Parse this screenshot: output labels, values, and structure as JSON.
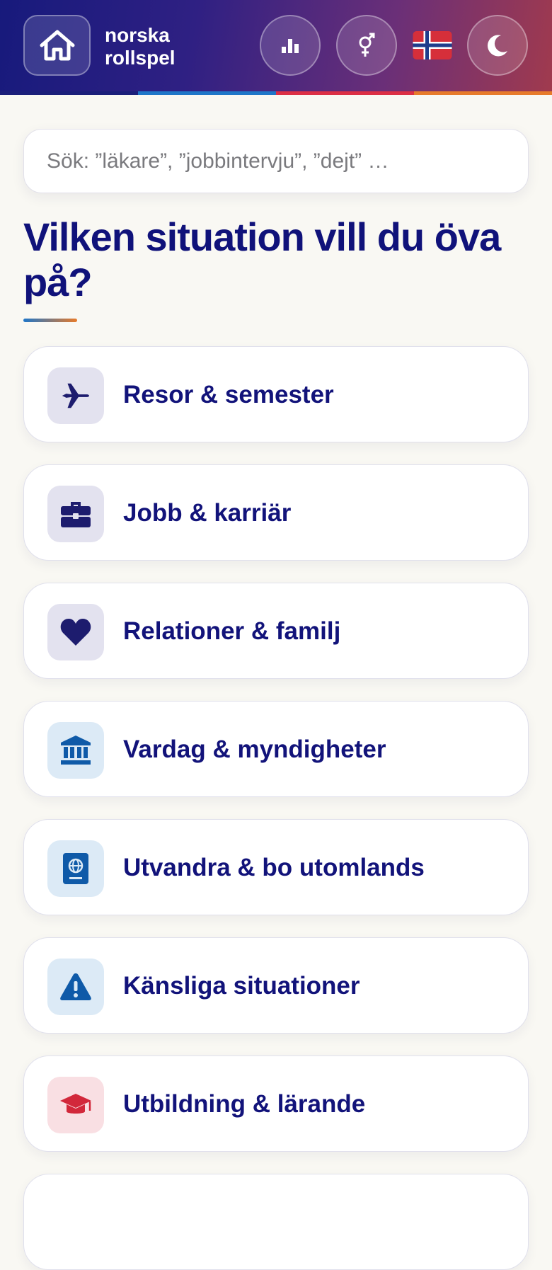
{
  "header": {
    "brand_line1": "norska",
    "brand_line2": "rollspel",
    "home_icon": "home-icon",
    "stats_icon": "bar-chart-icon",
    "gender_icon": "gender-icon",
    "flag_icon": "norway-flag-icon",
    "theme_icon": "moon-icon",
    "stripe_colors": [
      "#1b1f7a",
      "#1f76c8",
      "#dc2f45",
      "#e77b2b"
    ]
  },
  "search": {
    "placeholder": "Sök: ”läkare”, ”jobbintervju”, ”dejt” …"
  },
  "main": {
    "title": "Vilken situation vill du öva på?"
  },
  "categories": [
    {
      "label": "Resor & semester",
      "icon": "airplane-icon",
      "icon_bg": "#e3e2ef",
      "icon_color": "#1d1c6e"
    },
    {
      "label": "Jobb & karriär",
      "icon": "briefcase-icon",
      "icon_bg": "#e3e2ef",
      "icon_color": "#1d1c6e"
    },
    {
      "label": "Relationer & familj",
      "icon": "heart-icon",
      "icon_bg": "#e3e2ef",
      "icon_color": "#1d1c6e"
    },
    {
      "label": "Vardag & myndigheter",
      "icon": "building-icon",
      "icon_bg": "#dceaf6",
      "icon_color": "#0f5aa8"
    },
    {
      "label": "Utvandra & bo utomlands",
      "icon": "passport-icon",
      "icon_bg": "#dceaf6",
      "icon_color": "#0f5aa8"
    },
    {
      "label": "Känsliga situationer",
      "icon": "warning-icon",
      "icon_bg": "#dceaf6",
      "icon_color": "#0f5aa8"
    },
    {
      "label": "Utbildning & lärande",
      "icon": "graduation-cap-icon",
      "icon_bg": "#f9dfe3",
      "icon_color": "#d2283b"
    }
  ]
}
